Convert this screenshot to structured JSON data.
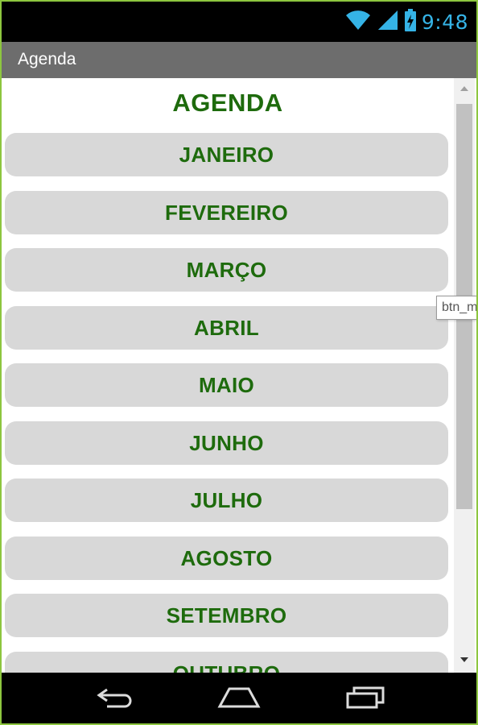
{
  "status": {
    "time": "9:48",
    "icons": [
      "wifi-icon",
      "signal-icon",
      "battery-charging-icon"
    ],
    "accent_color": "#35b3e6"
  },
  "app": {
    "title": "Agenda"
  },
  "main": {
    "heading": "AGENDA",
    "months": [
      "JANEIRO",
      "FEVEREIRO",
      "MARÇO",
      "ABRIL",
      "MAIO",
      "JUNHO",
      "JULHO",
      "AGOSTO",
      "SETEMBRO",
      "OUTUBRO"
    ],
    "tooltip": "btn_m"
  },
  "navigation": {
    "icons": [
      "back-icon",
      "home-icon",
      "recent-apps-icon"
    ]
  },
  "colors": {
    "text_green": "#1e6b0d",
    "button_gray": "#d8d8d8",
    "frame_green": "#8dc63f",
    "title_bar_gray": "#6d6d6d"
  }
}
